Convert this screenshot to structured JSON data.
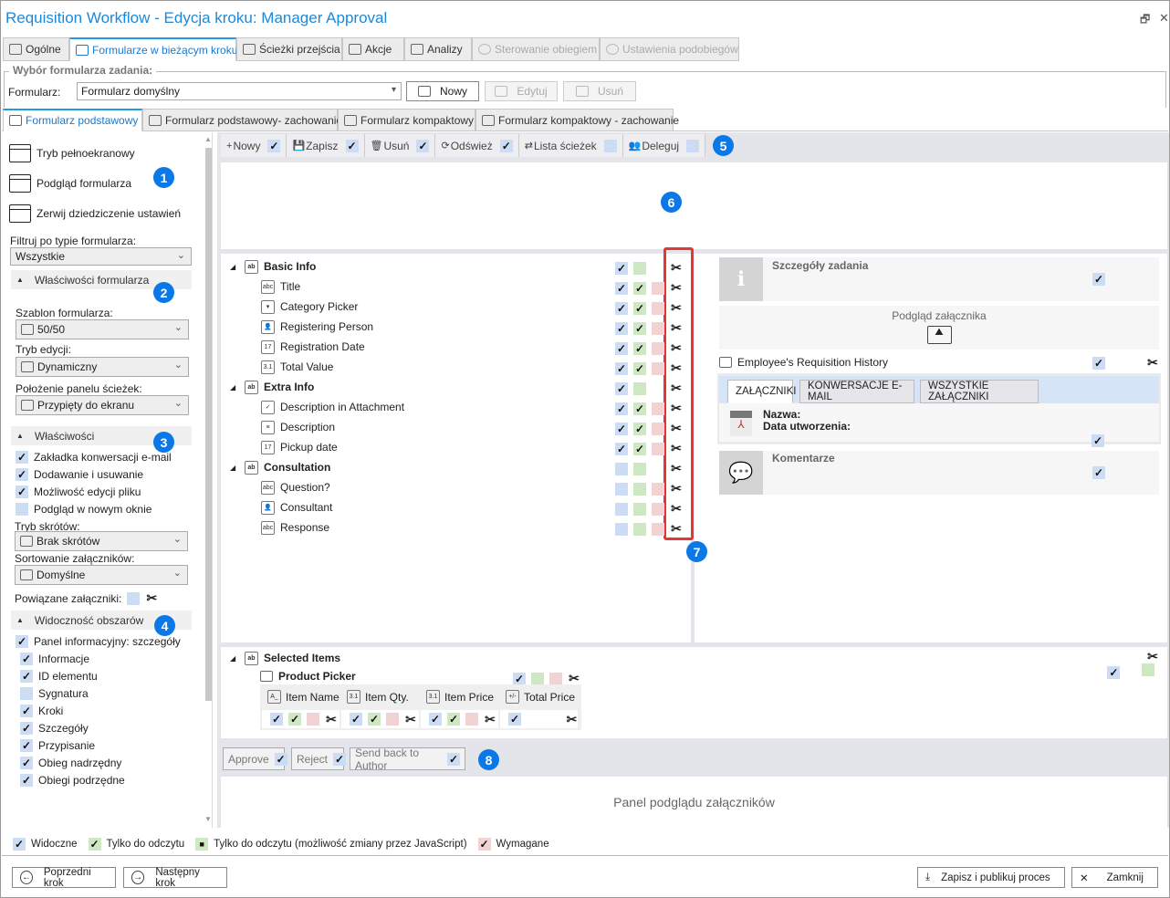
{
  "window": {
    "title": "Requisition Workflow - Edycja kroku: Manager Approval"
  },
  "tabs": [
    {
      "label": "Ogólne"
    },
    {
      "label": "Formularze w bieżącym kroku",
      "active": true
    },
    {
      "label": "Ścieżki przejścia"
    },
    {
      "label": "Akcje"
    },
    {
      "label": "Analizy"
    },
    {
      "label": "Sterowanie obiegiem",
      "disabled": true
    },
    {
      "label": "Ustawienia podobiegów",
      "disabled": true
    }
  ],
  "form_select": {
    "legend": "Wybór formularza zadania:",
    "label": "Formularz:",
    "value": "Formularz domyślny",
    "new": "Nowy",
    "edit": "Edytuj",
    "delete": "Usuń"
  },
  "subtabs": [
    {
      "label": "Formularz podstawowy",
      "active": true
    },
    {
      "label": "Formularz podstawowy- zachowanie"
    },
    {
      "label": "Formularz kompaktowy"
    },
    {
      "label": "Formularz kompaktowy - zachowanie"
    }
  ],
  "left": {
    "actions": [
      "Tryb pełnoekranowy",
      "Podgląd formularza",
      "Zerwij dziedziczenie ustawień"
    ],
    "filter_label": "Filtruj po typie formularza:",
    "filter_value": "Wszystkie",
    "sec_form": "Właściwości formularza",
    "template_label": "Szablon formularza:",
    "template_value": "50/50",
    "edit_label": "Tryb edycji:",
    "edit_value": "Dynamiczny",
    "paths_label": "Położenie panelu ścieżek:",
    "paths_value": "Przypięty do ekranu",
    "sec_props": "Właściwości",
    "props": [
      {
        "label": "Zakładka konwersacji e-mail",
        "checked": true
      },
      {
        "label": "Dodawanie i usuwanie",
        "checked": true
      },
      {
        "label": "Możliwość edycji pliku",
        "checked": true
      },
      {
        "label": "Podgląd w nowym oknie",
        "checked": false
      }
    ],
    "shortcut_label": "Tryb skrótów:",
    "shortcut_value": "Brak skrótów",
    "sort_label": "Sortowanie załączników:",
    "sort_value": "Domyślne",
    "related_label": "Powiązane załączniki:",
    "sec_vis": "Widoczność obszarów",
    "vis_main": {
      "label": "Panel informacyjny: szczegóły",
      "checked": true
    },
    "vis": [
      {
        "label": "Informacje",
        "checked": true
      },
      {
        "label": "ID elementu",
        "checked": true
      },
      {
        "label": "Sygnatura",
        "checked": false
      },
      {
        "label": "Kroki",
        "checked": true
      },
      {
        "label": "Szczegóły",
        "checked": true
      },
      {
        "label": "Przypisanie",
        "checked": true
      },
      {
        "label": "Obieg nadrzędny",
        "checked": true
      },
      {
        "label": "Obiegi podrzędne",
        "checked": true
      }
    ]
  },
  "toolbar": [
    {
      "icon": "plus",
      "label": "Nowy",
      "checked": true
    },
    {
      "icon": "save",
      "label": "Zapisz",
      "checked": true
    },
    {
      "icon": "trash",
      "label": "Usuń",
      "checked": true
    },
    {
      "icon": "refresh",
      "label": "Odśwież",
      "checked": true
    },
    {
      "icon": "paths",
      "label": "Lista ścieżek",
      "checked": false
    },
    {
      "icon": "delegate",
      "label": "Deleguj",
      "checked": false
    }
  ],
  "badges": [
    "1",
    "2",
    "3",
    "4",
    "5",
    "6",
    "7",
    "8"
  ],
  "tree": [
    {
      "label": "Basic Info",
      "group": true,
      "v": true,
      "ro": false
    },
    {
      "label": "Title",
      "icon": "abc",
      "v": true,
      "ro": true,
      "req": false
    },
    {
      "label": "Category Picker",
      "icon": "▾",
      "v": true,
      "ro": true,
      "req": false
    },
    {
      "label": "Registering Person",
      "icon": "👤",
      "v": true,
      "ro": true,
      "req": false
    },
    {
      "label": "Registration Date",
      "icon": "17",
      "v": true,
      "ro": true,
      "req": false
    },
    {
      "label": "Total Value",
      "icon": "3.1",
      "v": true,
      "ro": true,
      "req": false
    },
    {
      "label": "Extra Info",
      "group": true,
      "v": true,
      "ro": false
    },
    {
      "label": "Description in Attachment",
      "icon": "✓",
      "v": true,
      "ro": true,
      "req": false
    },
    {
      "label": "Description",
      "icon": "≡",
      "v": true,
      "ro": true,
      "req": false
    },
    {
      "label": "Pickup date",
      "icon": "17",
      "v": true,
      "ro": true,
      "req": false
    },
    {
      "label": "Consultation",
      "group": true,
      "v": false,
      "ro": false
    },
    {
      "label": "Question?",
      "icon": "abc",
      "v": false,
      "ro": false,
      "req": false
    },
    {
      "label": "Consultant",
      "icon": "👤",
      "v": false,
      "ro": false,
      "req": false
    },
    {
      "label": "Response",
      "icon": "abc",
      "v": false,
      "ro": false,
      "req": false
    }
  ],
  "right": {
    "task_details": "Szczegóły zadania",
    "attachment_preview": "Podgląd załącznika",
    "history": "Employee's Requisition History",
    "att_tabs": [
      "ZAŁĄCZNIKI",
      "KONWERSACJE E-MAIL",
      "WSZYSTKIE ZAŁĄCZNIKI"
    ],
    "name_label": "Nazwa:",
    "date_label": "Data utworzenia:",
    "comments": "Komentarze"
  },
  "selected": {
    "group": "Selected Items",
    "picker": "Product Picker",
    "columns": [
      {
        "label": "Item Name",
        "icon": "A_",
        "v": true,
        "ro": true,
        "req": false
      },
      {
        "label": "Item Qty.",
        "icon": "3.1",
        "v": true,
        "ro": true,
        "req": false
      },
      {
        "label": "Item Price",
        "icon": "3.1",
        "v": true,
        "ro": true,
        "req": false
      },
      {
        "label": "Total Price",
        "icon": "+/-",
        "v": true
      }
    ]
  },
  "actions": [
    {
      "label": "Approve",
      "checked": true
    },
    {
      "label": "Reject",
      "checked": true
    },
    {
      "label": "Send back to Author",
      "checked": true
    }
  ],
  "preview_panel": "Panel podglądu załączników",
  "legend": [
    {
      "label": "Widoczne",
      "color": "#cddcf5",
      "mark": "✓"
    },
    {
      "label": "Tylko do odczytu",
      "color": "#cfe8c4",
      "mark": "✓"
    },
    {
      "label": "Tylko do odczytu (możliwość zmiany przez JavaScript)",
      "color": "#cfe8c4",
      "mark": "■"
    },
    {
      "label": "Wymagane",
      "color": "#f2d3d3",
      "mark": "✓"
    }
  ],
  "footer": {
    "prev": "Poprzedni krok",
    "next": "Następny krok",
    "save": "Zapisz i publikuj proces",
    "close": "Zamknij"
  },
  "colors": {
    "accent": "#1e88d8",
    "badge": "#0a78e6",
    "highlight": "#e53535"
  }
}
